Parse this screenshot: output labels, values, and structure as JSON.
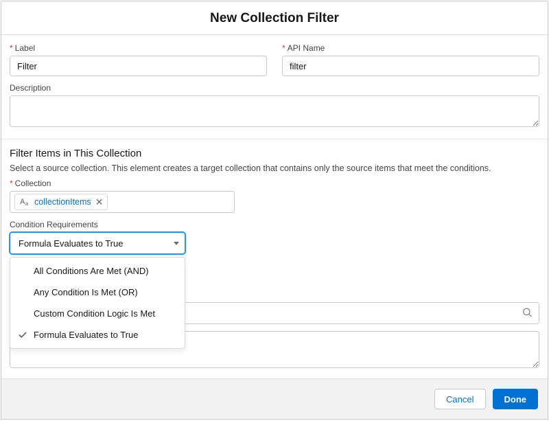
{
  "modal": {
    "title": "New Collection Filter"
  },
  "fields": {
    "label_label": "Label",
    "label_value": "Filter",
    "apiName_label": "API Name",
    "apiName_value": "filter",
    "description_label": "Description",
    "description_value": ""
  },
  "filterSection": {
    "title": "Filter Items in This Collection",
    "help": "Select a source collection. This element creates a target collection that contains only the source items that meet the conditions.",
    "collection_label": "Collection",
    "collection_pill_text": "collectionItems",
    "condition_label": "Condition Requirements",
    "condition_selected": "Formula Evaluates to True",
    "condition_options": [
      "All Conditions Are Met (AND)",
      "Any Condition Is Met (OR)",
      "Custom Condition Logic Is Met",
      "Formula Evaluates to True"
    ],
    "formula_value": "",
    "formula_body": ""
  },
  "footer": {
    "cancel": "Cancel",
    "done": "Done"
  }
}
